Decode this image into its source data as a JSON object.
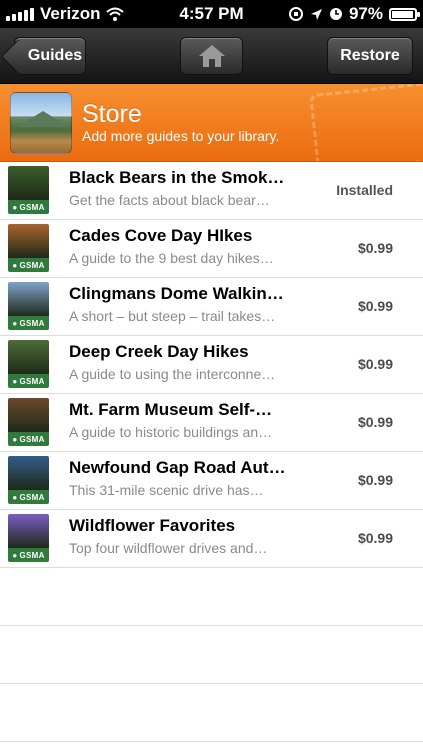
{
  "status_bar": {
    "carrier": "Verizon",
    "time": "4:57 PM",
    "battery": "97%",
    "battery_level": 0.97,
    "icons": [
      "signal-icon",
      "wifi-icon",
      "rotation-lock-icon",
      "location-icon",
      "alarm-icon",
      "battery-icon"
    ]
  },
  "nav": {
    "back_label": "Guides",
    "home_icon": "home-icon",
    "restore_label": "Restore"
  },
  "store": {
    "title": "Store",
    "subtitle": "Add more guides to your library."
  },
  "badge_text": "GSMA",
  "guides": [
    {
      "title": "Black Bears in the Smok…",
      "description": "Get the facts about black bear…",
      "price": "Installed",
      "thumb_color": "#3b5d2a"
    },
    {
      "title": "Cades Cove Day HIkes",
      "description": "A guide to the 9 best day hikes…",
      "price": "$0.99",
      "thumb_color": "#a8652c"
    },
    {
      "title": "Clingmans Dome Walkin…",
      "description": "A short – but steep – trail takes…",
      "price": "$0.99",
      "thumb_color": "#7fa2c8"
    },
    {
      "title": "Deep Creek Day Hikes",
      "description": "A guide to using the interconne…",
      "price": "$0.99",
      "thumb_color": "#4d6b37"
    },
    {
      "title": "Mt. Farm Museum Self-…",
      "description": "A guide to historic buildings an…",
      "price": "$0.99",
      "thumb_color": "#6b4a2c"
    },
    {
      "title": "Newfound Gap Road Aut…",
      "description": "This 31-mile scenic drive has…",
      "price": "$0.99",
      "thumb_color": "#345c8a"
    },
    {
      "title": "Wildflower Favorites",
      "description": "Top four wildflower drives and…",
      "price": "$0.99",
      "thumb_color": "#7c5cc4"
    }
  ],
  "empty_rows": 3
}
